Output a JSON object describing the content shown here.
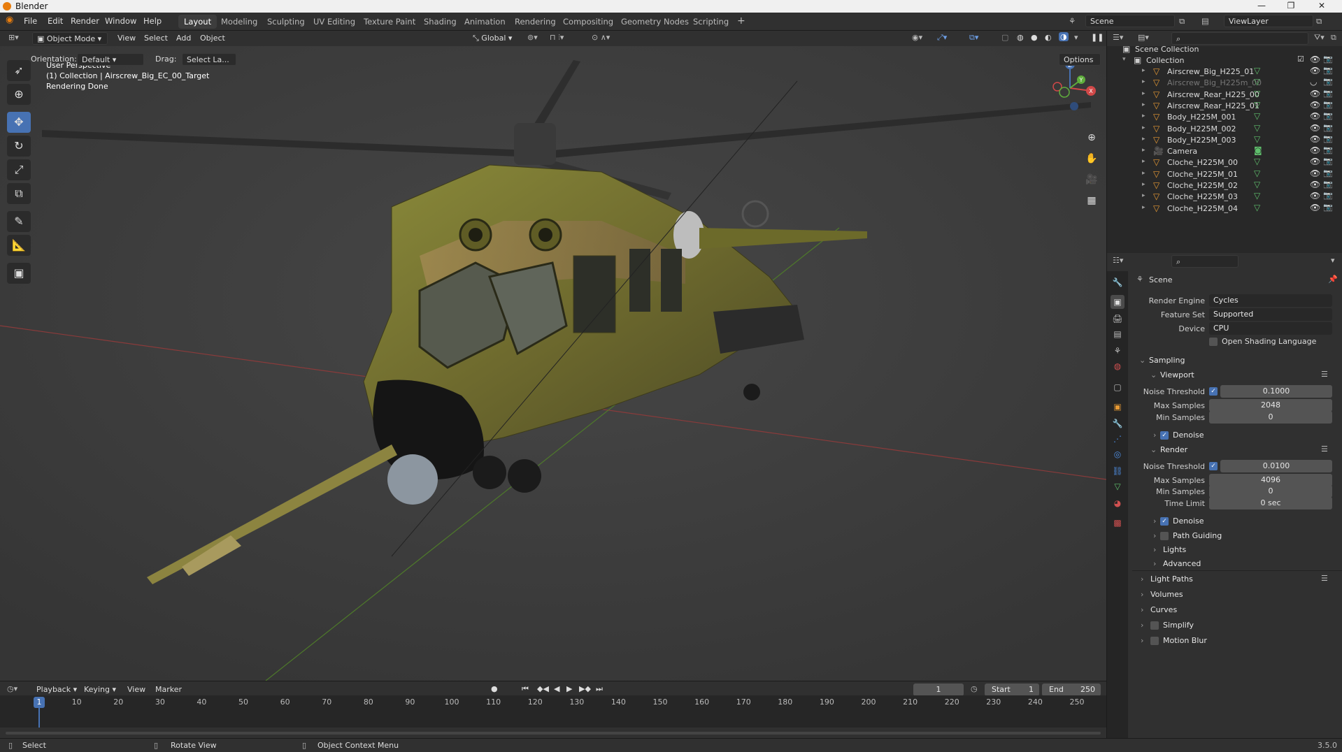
{
  "app_title": "Blender",
  "menu": [
    "File",
    "Edit",
    "Render",
    "Window",
    "Help"
  ],
  "workspaces": [
    "Layout",
    "Modeling",
    "Sculpting",
    "UV Editing",
    "Texture Paint",
    "Shading",
    "Animation",
    "Rendering",
    "Compositing",
    "Geometry Nodes",
    "Scripting"
  ],
  "workspace_add": "+",
  "scene_name": "Scene",
  "view_layer": "ViewLayer",
  "header": {
    "mode": "Object Mode",
    "menus": [
      "View",
      "Select",
      "Add",
      "Object"
    ],
    "transform_orientation": "Global",
    "orientation_label": "Orientation:",
    "orientation_value": "Default",
    "drag_label": "Drag:",
    "drag_value": "Select La...",
    "options": "Options"
  },
  "viewport_overlay": {
    "line1": "User Perspective",
    "line2": "(1) Collection | Airscrew_Big_EC_00_Target",
    "line3": "Rendering Done"
  },
  "gizmo": {
    "x": "X",
    "y": "Y",
    "z": "Z"
  },
  "outliner": {
    "root": "Scene Collection",
    "collection": "Collection",
    "items": [
      {
        "name": "Airscrew_Big_H225_01",
        "type": "mesh",
        "dim": false
      },
      {
        "name": "Airscrew_Big_H225m_00",
        "type": "mesh",
        "dim": true
      },
      {
        "name": "Airscrew_Rear_H225_00",
        "type": "mesh",
        "dim": false
      },
      {
        "name": "Airscrew_Rear_H225_01",
        "type": "mesh",
        "dim": false
      },
      {
        "name": "Body_H225M_001",
        "type": "mesh",
        "dim": false
      },
      {
        "name": "Body_H225M_002",
        "type": "mesh",
        "dim": false
      },
      {
        "name": "Body_H225M_003",
        "type": "mesh",
        "dim": false
      },
      {
        "name": "Camera",
        "type": "camera",
        "dim": false
      },
      {
        "name": "Cloche_H225M_00",
        "type": "mesh",
        "dim": false
      },
      {
        "name": "Cloche_H225M_01",
        "type": "mesh",
        "dim": false
      },
      {
        "name": "Cloche_H225M_02",
        "type": "mesh",
        "dim": false
      },
      {
        "name": "Cloche_H225M_03",
        "type": "mesh",
        "dim": false
      },
      {
        "name": "Cloche_H225M_04",
        "type": "mesh",
        "dim": false
      }
    ]
  },
  "properties": {
    "context": "Scene",
    "render_engine_label": "Render Engine",
    "render_engine": "Cycles",
    "feature_set_label": "Feature Set",
    "feature_set": "Supported",
    "device_label": "Device",
    "device": "CPU",
    "osl": "Open Shading Language",
    "sampling": "Sampling",
    "viewport": "Viewport",
    "noise_threshold_label": "Noise Threshold",
    "vp_noise_threshold": "0.1000",
    "max_samples_label": "Max Samples",
    "vp_max_samples": "2048",
    "min_samples_label": "Min Samples",
    "vp_min_samples": "0",
    "denoise": "Denoise",
    "render": "Render",
    "r_noise_threshold": "0.0100",
    "r_max_samples": "4096",
    "r_min_samples": "0",
    "time_limit_label": "Time Limit",
    "time_limit": "0 sec",
    "path_guiding": "Path Guiding",
    "lights": "Lights",
    "advanced": "Advanced",
    "light_paths": "Light Paths",
    "volumes": "Volumes",
    "curves": "Curves",
    "simplify": "Simplify",
    "motion_blur": "Motion Blur"
  },
  "timeline": {
    "menus": [
      "Playback",
      "Keying",
      "View",
      "Marker"
    ],
    "current_frame": "1",
    "start_label": "Start",
    "start": "1",
    "end_label": "End",
    "end": "250",
    "ticks": [
      "1",
      "10",
      "20",
      "30",
      "40",
      "50",
      "60",
      "70",
      "80",
      "90",
      "100",
      "110",
      "120",
      "130",
      "140",
      "150",
      "160",
      "170",
      "180",
      "190",
      "200",
      "210",
      "220",
      "230",
      "240",
      "250"
    ]
  },
  "statusbar": {
    "select": "Select",
    "rotate": "Rotate View",
    "context_menu": "Object Context Menu",
    "version": "3.5.0"
  },
  "colors": {
    "accent": "#4772b3",
    "orange": "#e79a34",
    "mesh_green": "#5fbf6c"
  }
}
